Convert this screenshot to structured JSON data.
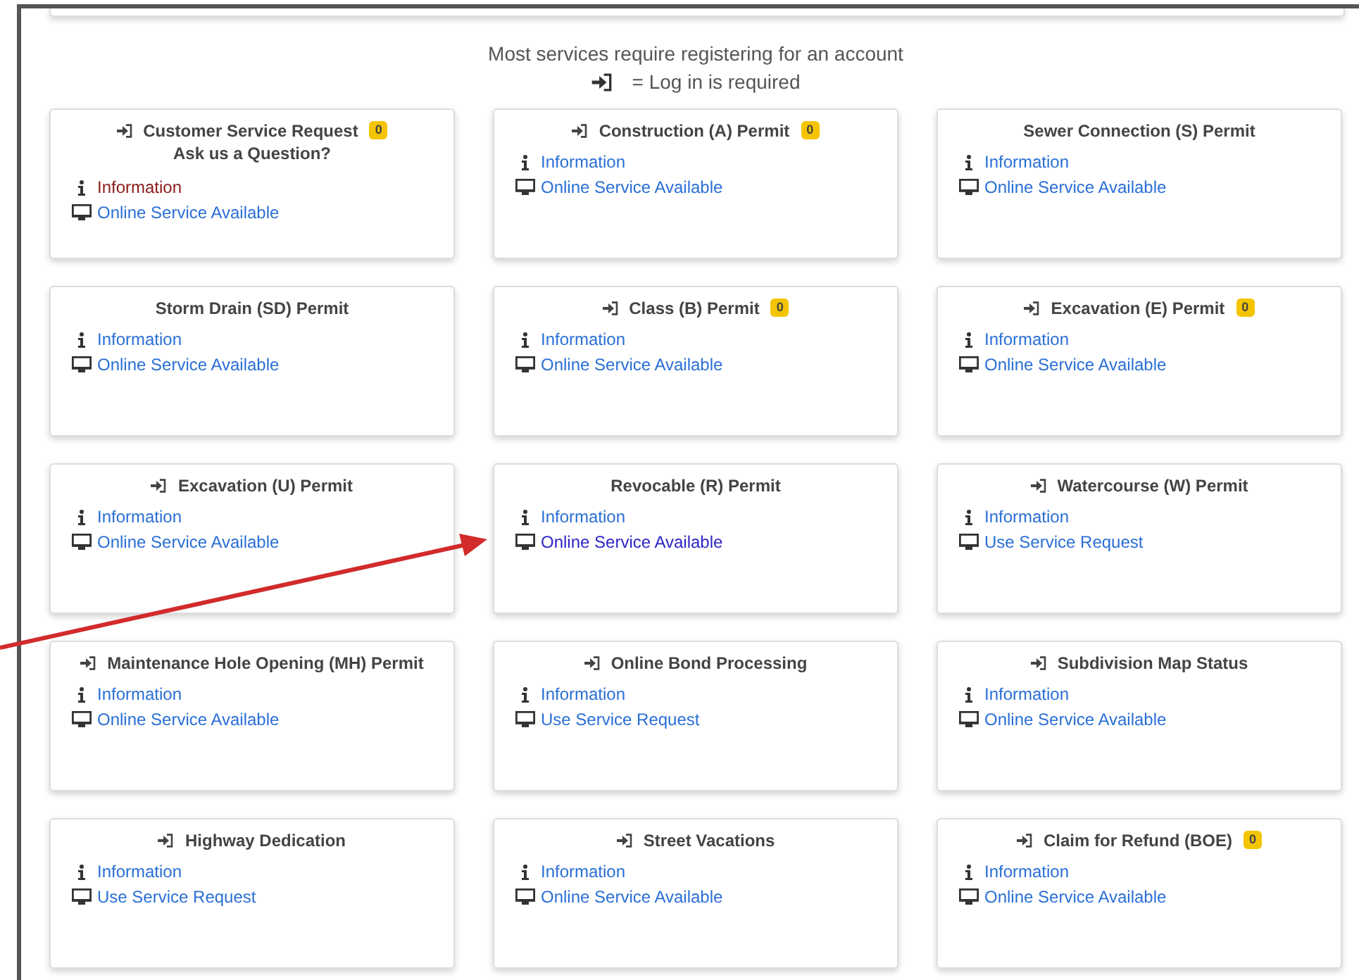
{
  "intro": {
    "text": "Most services require registering for an account",
    "legend": "= Log in is required"
  },
  "cards": [
    {
      "title": "Customer Service Request",
      "login": true,
      "badge": "0",
      "subtitle": "Ask us a Question?",
      "links": [
        {
          "kind": "info",
          "label": "Information",
          "visited": true
        },
        {
          "kind": "online",
          "label": "Online Service Available",
          "visited": false
        }
      ]
    },
    {
      "title": "Construction (A) Permit",
      "login": true,
      "badge": "0",
      "links": [
        {
          "kind": "info",
          "label": "Information",
          "visited": false
        },
        {
          "kind": "online",
          "label": "Online Service Available",
          "visited": false
        }
      ]
    },
    {
      "title": "Sewer Connection (S) Permit",
      "login": false,
      "links": [
        {
          "kind": "info",
          "label": "Information",
          "visited": false
        },
        {
          "kind": "online",
          "label": "Online Service Available",
          "visited": false
        }
      ]
    },
    {
      "title": "Storm Drain (SD) Permit",
      "login": false,
      "links": [
        {
          "kind": "info",
          "label": "Information",
          "visited": false
        },
        {
          "kind": "online",
          "label": "Online Service Available",
          "visited": false
        }
      ]
    },
    {
      "title": "Class (B) Permit",
      "login": true,
      "badge": "0",
      "links": [
        {
          "kind": "info",
          "label": "Information",
          "visited": false
        },
        {
          "kind": "online",
          "label": "Online Service Available",
          "visited": false
        }
      ]
    },
    {
      "title": "Excavation (E) Permit",
      "login": true,
      "badge": "0",
      "links": [
        {
          "kind": "info",
          "label": "Information",
          "visited": false
        },
        {
          "kind": "online",
          "label": "Online Service Available",
          "visited": false
        }
      ]
    },
    {
      "title": "Excavation (U) Permit",
      "login": true,
      "links": [
        {
          "kind": "info",
          "label": "Information",
          "visited": false
        },
        {
          "kind": "online",
          "label": "Online Service Available",
          "visited": false
        }
      ]
    },
    {
      "title": "Revocable (R) Permit",
      "login": false,
      "links": [
        {
          "kind": "info",
          "label": "Information",
          "visited": false
        },
        {
          "kind": "online",
          "label": "Online Service Available",
          "visited": true
        }
      ]
    },
    {
      "title": "Watercourse (W) Permit",
      "login": true,
      "links": [
        {
          "kind": "info",
          "label": "Information",
          "visited": false
        },
        {
          "kind": "online",
          "label": "Use Service Request",
          "visited": false
        }
      ]
    },
    {
      "title": "Maintenance Hole Opening (MH) Permit",
      "login": true,
      "links": [
        {
          "kind": "info",
          "label": "Information",
          "visited": false
        },
        {
          "kind": "online",
          "label": "Online Service Available",
          "visited": false
        }
      ]
    },
    {
      "title": "Online Bond Processing",
      "login": true,
      "links": [
        {
          "kind": "info",
          "label": "Information",
          "visited": false
        },
        {
          "kind": "online",
          "label": "Use Service Request",
          "visited": false
        }
      ]
    },
    {
      "title": "Subdivision Map Status",
      "login": true,
      "links": [
        {
          "kind": "info",
          "label": "Information",
          "visited": false
        },
        {
          "kind": "online",
          "label": "Online Service Available",
          "visited": false
        }
      ]
    },
    {
      "title": "Highway Dedication",
      "login": true,
      "links": [
        {
          "kind": "info",
          "label": "Information",
          "visited": false
        },
        {
          "kind": "online",
          "label": "Use Service Request",
          "visited": false
        }
      ]
    },
    {
      "title": "Street Vacations",
      "login": true,
      "links": [
        {
          "kind": "info",
          "label": "Information",
          "visited": false
        },
        {
          "kind": "online",
          "label": "Online Service Available",
          "visited": false
        }
      ]
    },
    {
      "title": "Claim for Refund (BOE)",
      "login": true,
      "badge": "0",
      "links": [
        {
          "kind": "info",
          "label": "Information",
          "visited": false
        },
        {
          "kind": "online",
          "label": "Online Service Available",
          "visited": false
        }
      ]
    }
  ]
}
